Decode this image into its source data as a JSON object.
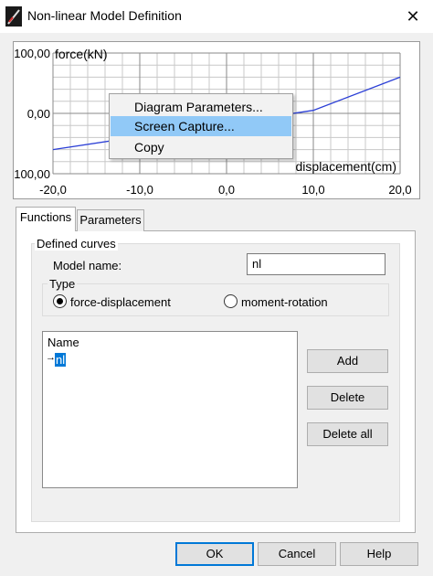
{
  "window": {
    "title": "Non-linear Model Definition",
    "close_icon": "close-icon",
    "app_icon": "app-icon"
  },
  "chart_data": {
    "type": "line",
    "title": "",
    "xlabel": "displacement(cm)",
    "ylabel": "force(kN)",
    "x_tick_labels": [
      "-20,0",
      "-10,0",
      "0,0",
      "10,0",
      "20,0"
    ],
    "y_tick_labels": [
      "100,00",
      "0,00",
      "100,00"
    ],
    "xlim": [
      -20,
      20
    ],
    "ylim": [
      -100,
      100
    ],
    "grid": true,
    "series": [
      {
        "x": [
          -20,
          10,
          20
        ],
        "y": [
          -60,
          5,
          60
        ]
      }
    ]
  },
  "context_menu": {
    "items": [
      {
        "label": "Diagram Parameters..."
      },
      {
        "label": "Screen Capture..."
      },
      {
        "label": "Copy"
      }
    ]
  },
  "tabs": [
    {
      "label": "Functions"
    },
    {
      "label": "Parameters"
    }
  ],
  "defined_curves": {
    "group_label": "Defined curves",
    "model_name_label": "Model name:",
    "model_name_value": "nl",
    "type_label": "Type",
    "type_options": [
      {
        "label": "force-displacement",
        "selected": true
      },
      {
        "label": "moment-rotation",
        "selected": false
      }
    ],
    "list_header": "Name",
    "list_items": [
      {
        "label": "nl",
        "marker": "→"
      }
    ],
    "buttons": {
      "add": "Add",
      "delete": "Delete",
      "delete_all": "Delete all"
    }
  },
  "footer": {
    "ok": "OK",
    "cancel": "Cancel",
    "help": "Help"
  }
}
